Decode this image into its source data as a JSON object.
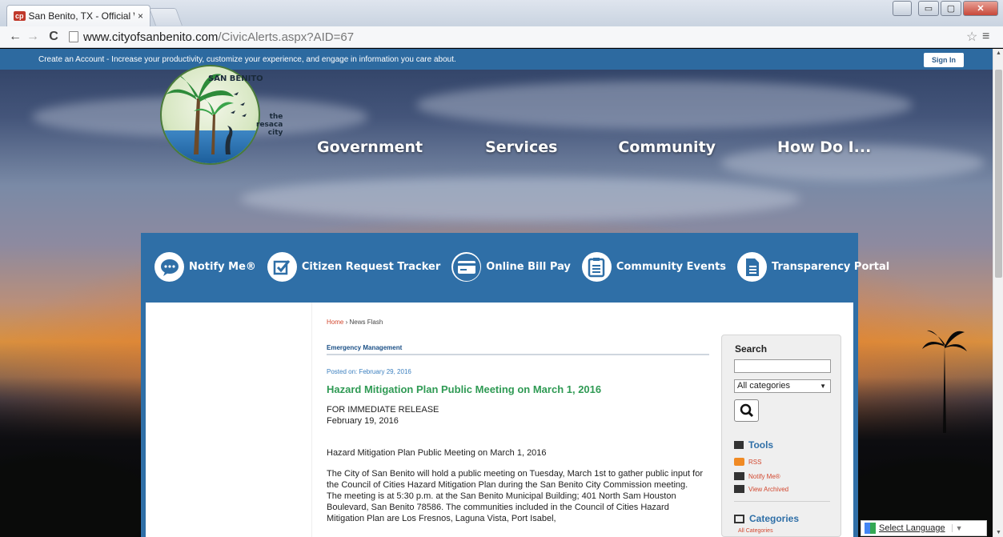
{
  "browser": {
    "tab_title": "San Benito, TX - Official W",
    "favicon_text": "cp",
    "tab_close": "×",
    "url_host": "www.cityofsanbenito.com",
    "url_path": "/CivicAlerts.aspx?AID=67",
    "back": "←",
    "forward": "→",
    "reload": "C",
    "star": "☆",
    "menu": "≡",
    "win_min": "▭",
    "win_max": "▢",
    "win_close": "✕"
  },
  "account_bar": {
    "text": "Create an Account - Increase your productivity, customize your experience, and engage in information you care about.",
    "sign_in": "Sign In"
  },
  "logo": {
    "name": "SAN BENITO",
    "tag_1": "the",
    "tag_2": "resaca",
    "tag_3": "city"
  },
  "main_nav": [
    "Government",
    "Services",
    "Community",
    "How Do I..."
  ],
  "quick_links": [
    {
      "label": "Notify Me®",
      "icon": "chat-bubble-icon"
    },
    {
      "label": "Citizen Request Tracker",
      "icon": "checkbox-icon"
    },
    {
      "label": "Online Bill Pay",
      "icon": "credit-card-icon"
    },
    {
      "label": "Community Events",
      "icon": "clipboard-icon"
    },
    {
      "label": "Transparency Portal",
      "icon": "document-icon"
    }
  ],
  "breadcrumb": {
    "home": "Home",
    "separator": "›",
    "current": "News Flash"
  },
  "article": {
    "category": "Emergency Management",
    "posted": "Posted on: February 29, 2016",
    "headline": "Hazard Mitigation Plan Public Meeting on March 1, 2016",
    "release": "FOR IMMEDIATE RELEASE",
    "release_date": "February 19, 2016",
    "subhead": "Hazard Mitigation Plan Public Meeting on March 1, 2016",
    "body": "The City of San Benito will hold a public meeting on Tuesday, March 1st to gather public input for the Council of Cities Hazard Mitigation Plan during the San Benito City Commission meeting. The meeting is at 5:30 p.m. at the San Benito Municipal Building; 401 North Sam Houston Boulevard, San Benito 78586. The communities included in the Council of Cities Hazard Mitigation Plan are Los Fresnos, Laguna Vista, Port Isabel,"
  },
  "sidebar": {
    "search_heading": "Search",
    "search_value": "",
    "category_selected": "All categories",
    "tools_heading": "Tools",
    "tools": [
      "RSS",
      "Notify Me®",
      "View Archived"
    ],
    "categories_heading": "Categories",
    "categories": [
      "All Categories"
    ]
  },
  "translate": {
    "label": "Select Language",
    "arrow": "▼"
  },
  "colors": {
    "account_bar": "#2d6aa0",
    "quick_bar": "#2f6fa7",
    "headline": "#2f9a54",
    "link": "#d2472e",
    "category": "#1a4f86"
  }
}
